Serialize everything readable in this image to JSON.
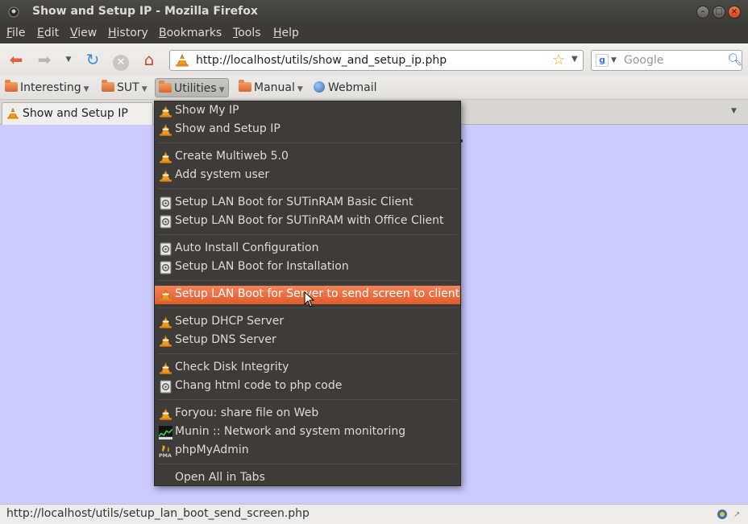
{
  "window": {
    "title": "Show and Setup IP - Mozilla Firefox"
  },
  "menubar": [
    "File",
    "Edit",
    "View",
    "History",
    "Bookmarks",
    "Tools",
    "Help"
  ],
  "navigation": {
    "url": "http://localhost/utils/show_and_setup_ip.php",
    "search_placeholder": "Google",
    "search_engine_letter": "g"
  },
  "bookmarks": {
    "items": [
      "Interesting",
      "SUT",
      "Utilities",
      "Manual",
      "Webmail"
    ]
  },
  "tab": {
    "title": "Show and Setup IP"
  },
  "dropdown": {
    "items": [
      "Show My IP",
      "Show and Setup IP",
      "Create Multiweb 5.0",
      "Add system user",
      "Setup LAN Boot for SUTinRAM Basic Client",
      "Setup LAN Boot for SUTinRAM with Office Client",
      "Auto Install Configuration",
      "Setup LAN Boot for Installation",
      "Setup LAN Boot for Server to send screen to client",
      "Setup DHCP Server",
      "Setup DNS Server",
      "Check Disk Integrity",
      "Chang html code to php code",
      "Foryou: share file on Web",
      "Munin :: Network and system monitoring",
      "phpMyAdmin",
      "Open All in Tabs"
    ],
    "highlighted": "Setup LAN Boot for Server to send screen to client"
  },
  "status": {
    "text": "http://localhost/utils/setup_lan_boot_send_screen.php"
  },
  "colors": {
    "content_background": "#cbcbff",
    "menu_background": "#3d3c38",
    "highlight": "#e9693a"
  }
}
